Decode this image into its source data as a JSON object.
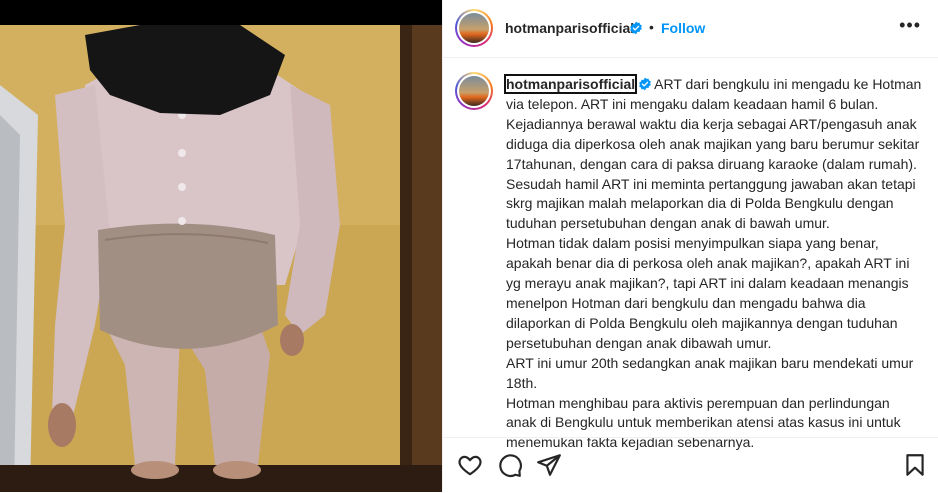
{
  "post": {
    "username": "hotmanparisofficial",
    "verified": true,
    "follow_label": "Follow",
    "separator": "•",
    "more_icon": "more-options-icon"
  },
  "caption": {
    "username": "hotmanparisofficial",
    "lines": [
      "ART dari bengkulu ini mengadu ke Hotman via telepon. ART ini mengaku dalam keadaan hamil 6 bulan. Kejadiannya berawal waktu dia kerja sebagai ART/pengasuh anak diduga dia diperkosa oleh anak majikan yang baru berumur sekitar 17tahunan, dengan cara di paksa diruang karaoke (dalam rumah). Sesudah hamil ART ini meminta pertanggung jawaban akan tetapi skrg majikan malah melaporkan dia di Polda Bengkulu dengan tuduhan persetubuhan dengan anak di bawah umur.",
      "Hotman tidak dalam posisi menyimpulkan siapa yang benar, apakah benar dia di perkosa oleh anak majikan?, apakah ART ini yg merayu anak majikan?, tapi ART ini dalam keadaan menangis menelpon Hotman dari bengkulu dan mengadu bahwa dia dilaporkan di Polda Bengkulu oleh majikannya dengan tuduhan persetubuhan dengan anak dibawah umur.",
      "ART ini umur 20th sedangkan anak majikan baru mendekati umur 18th.",
      "Hotman menghibau para aktivis perempuan dan perlindungan anak di Bengkulu untuk memberikan atensi atas kasus ini untuk menemukan fakta kejadian sebenarnya."
    ]
  },
  "actions": [
    "heart-icon",
    "comment-icon",
    "share-icon",
    "bookmark-icon"
  ],
  "colors": {
    "accent": "#0095f6",
    "text": "#262626",
    "border": "#efefef"
  }
}
